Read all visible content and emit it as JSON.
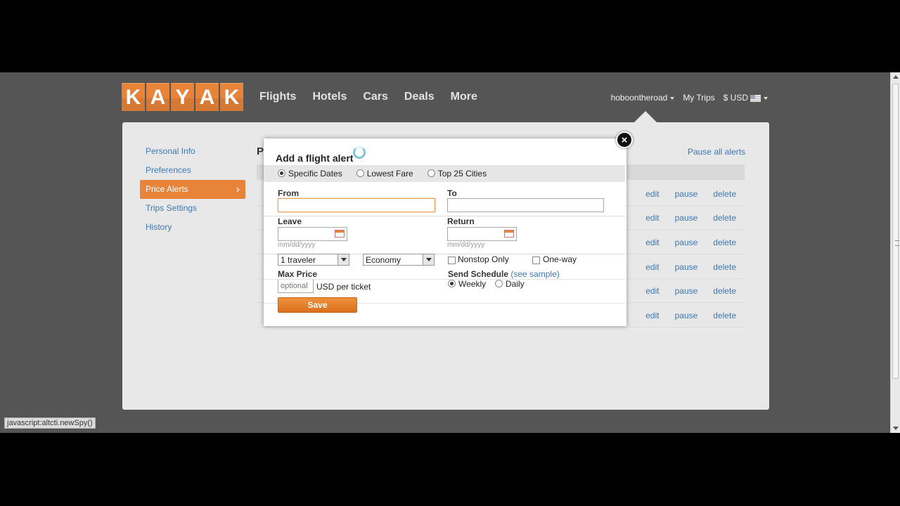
{
  "header": {
    "logo_letters": [
      "K",
      "A",
      "Y",
      "A",
      "K"
    ],
    "nav": [
      "Flights",
      "Hotels",
      "Cars",
      "Deals",
      "More"
    ],
    "user": "hoboontheroad",
    "my_trips": "My Trips",
    "currency": "$ USD"
  },
  "sidebar": {
    "items": [
      "Personal Info",
      "Preferences",
      "Price Alerts",
      "Trips Settings",
      "History"
    ],
    "active_index": 2
  },
  "main": {
    "title_fragment": "P",
    "pause_all": "Pause all alerts",
    "row_actions": [
      "edit",
      "pause",
      "delete"
    ],
    "row_count": 6
  },
  "modal": {
    "title": "Add a flight alert",
    "modes": [
      "Specific Dates",
      "Lowest Fare",
      "Top 25 Cities"
    ],
    "selected_mode": "Specific Dates",
    "from_label": "From",
    "from_value": "",
    "to_label": "To",
    "to_value": "",
    "leave_label": "Leave",
    "return_label": "Return",
    "date_hint": "mm/dd/yyyy",
    "travelers": "1 traveler",
    "cabin": "Economy",
    "nonstop": "Nonstop Only",
    "oneway": "One-way",
    "max_price_label": "Max Price",
    "max_price_placeholder": "optional",
    "price_unit": "USD per ticket",
    "schedule_label": "Send Schedule",
    "see_sample": "(see sample)",
    "schedule_options": [
      "Weekly",
      "Daily"
    ],
    "selected_schedule": "Weekly",
    "save": "Save",
    "close": "×"
  },
  "statusbar": "javascript:altcti.newSpy()"
}
